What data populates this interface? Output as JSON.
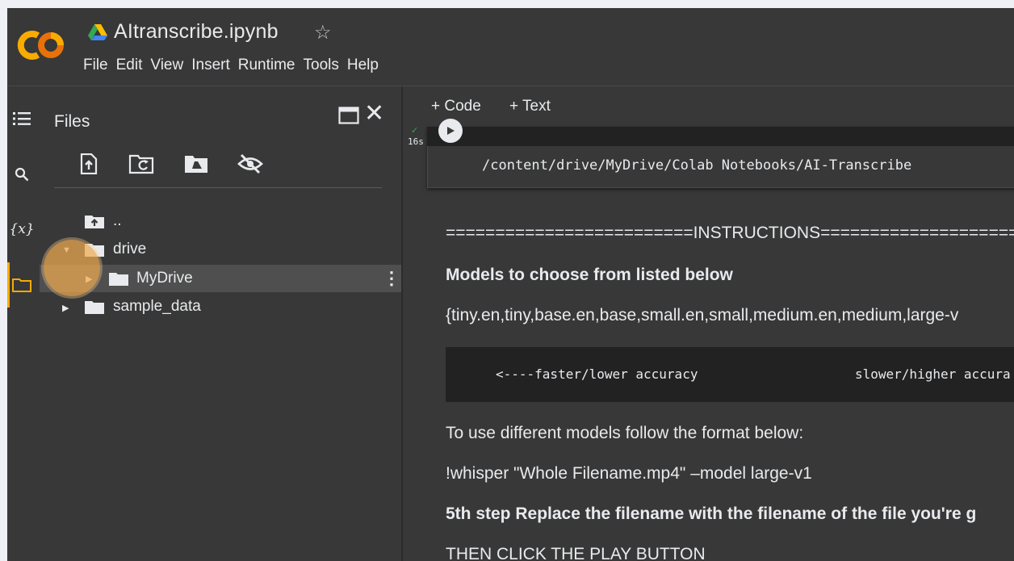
{
  "header": {
    "title": "AItranscribe.ipynb",
    "star_icon": "star-outline-icon",
    "brand_colors": {
      "logo_orange": "#f9ab00",
      "logo_dark": "#e8710a"
    },
    "menu": [
      "File",
      "Edit",
      "View",
      "Insert",
      "Runtime",
      "Tools",
      "Help"
    ]
  },
  "rail": {
    "icons": [
      "table-of-contents-icon",
      "search-icon",
      "variables-icon",
      "files-icon"
    ],
    "variables_label": "{x}",
    "active_color": "#f9ab00"
  },
  "files_panel": {
    "title": "Files",
    "tools": [
      "upload-file-icon",
      "refresh-icon",
      "mount-drive-icon",
      "hide-files-icon"
    ],
    "tree": [
      {
        "label": "..",
        "icon": "parent-folder-icon"
      },
      {
        "label": "drive",
        "expanded": true
      },
      {
        "label": "MyDrive",
        "selected": true
      },
      {
        "label": "sample_data"
      }
    ]
  },
  "notebook": {
    "toolbar": {
      "code_label": "+ Code",
      "text_label": "+ Text"
    },
    "cell": {
      "run_time": "16s",
      "output": "/content/drive/MyDrive/Colab Notebooks/AI-Transcribe"
    },
    "markdown": {
      "instructions": "=========================INSTRUCTIONS====================",
      "models_heading": "Models to choose from listed below",
      "models_list": "{tiny.en,tiny,base.en,base,small.en,small,medium.en,medium,large-v",
      "code_left": "<----faster/lower accuracy",
      "code_right": "slower/higher accura",
      "format_text": "To use different models follow the format below:",
      "example_cmd": "!whisper \"Whole Filename.mp4\" –model large-v1",
      "step5": "5th step Replace the filename with the filename of the file you're g",
      "play_text": "THEN CLICK THE PLAY BUTTON"
    }
  }
}
